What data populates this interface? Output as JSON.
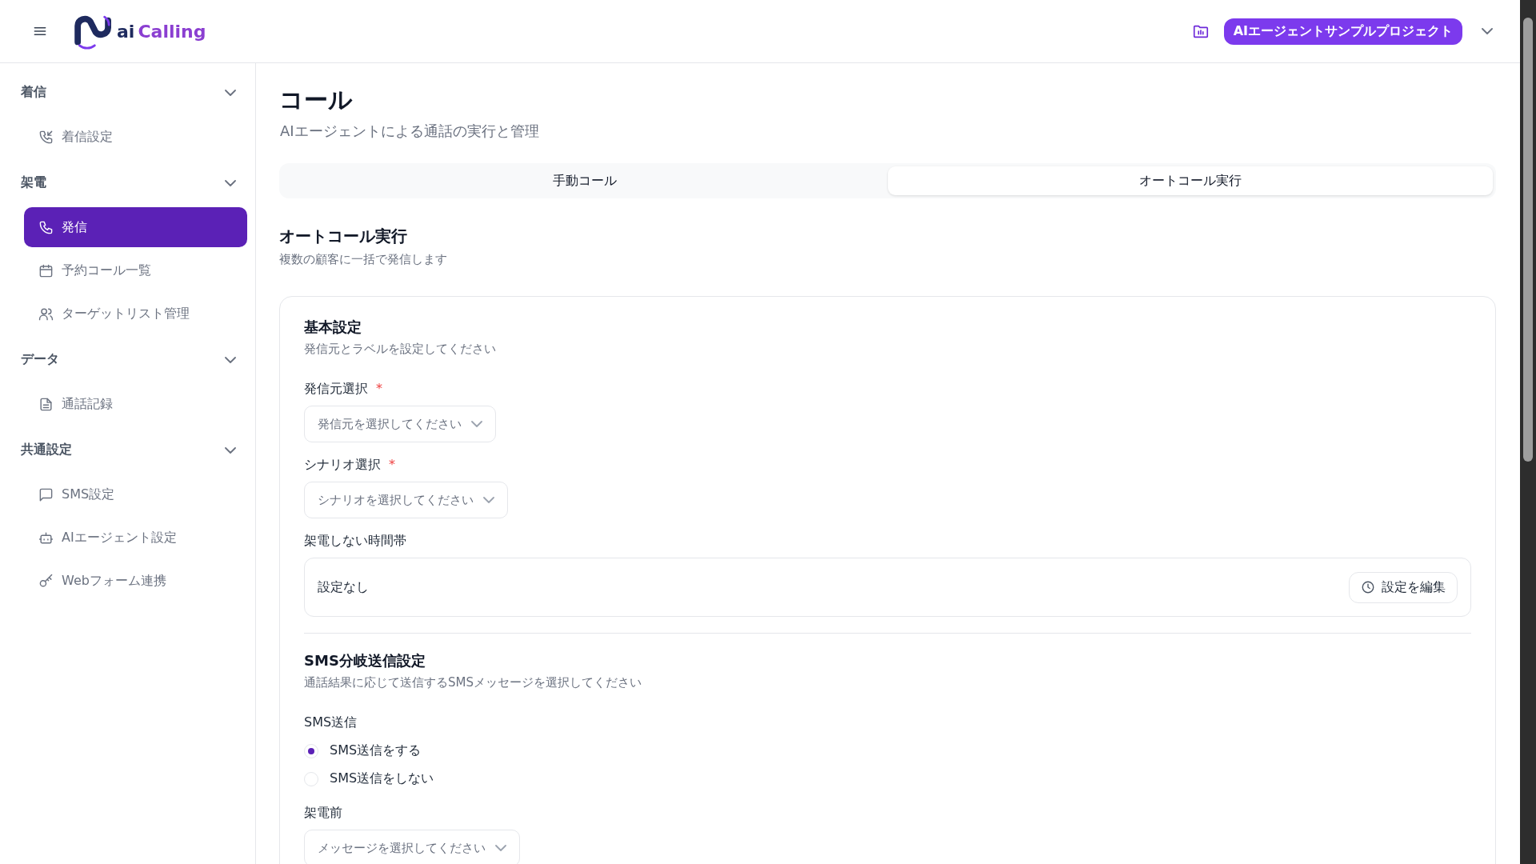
{
  "header": {
    "logo": {
      "prefix": "ai",
      "name": "Calling"
    },
    "project": "AIエージェントサンプルプロジェクト"
  },
  "sidebar": {
    "groups": [
      {
        "label": "着信",
        "expanded": true,
        "items": [
          {
            "label": "着信設定",
            "selected": false
          }
        ]
      },
      {
        "label": "架電",
        "expanded": true,
        "items": [
          {
            "label": "発信",
            "selected": true
          },
          {
            "label": "予約コール一覧",
            "selected": false
          },
          {
            "label": "ターゲットリスト管理",
            "selected": false
          }
        ]
      },
      {
        "label": "データ",
        "expanded": true,
        "items": [
          {
            "label": "通話記録",
            "selected": false
          }
        ]
      },
      {
        "label": "共通設定",
        "expanded": true,
        "items": [
          {
            "label": "SMS設定",
            "selected": false
          },
          {
            "label": "AIエージェント設定",
            "selected": false
          },
          {
            "label": "Webフォーム連携",
            "selected": false
          }
        ]
      }
    ]
  },
  "page": {
    "title": "コール",
    "subtitle": "AIエージェントによる通話の実行と管理"
  },
  "tabs": [
    {
      "label": "手動コール",
      "selected": false
    },
    {
      "label": "オートコール実行",
      "selected": true
    }
  ],
  "section": {
    "title": "オートコール実行",
    "subtitle": "複数の顧客に一括で発信します"
  },
  "card": {
    "blocks": [
      {
        "kind": "heading",
        "title": "基本設定",
        "description": "発信元とラベルを設定してください"
      },
      {
        "kind": "select",
        "label": "発信元選択",
        "required_mark": "*",
        "placeholder": "発信元を選択してください"
      },
      {
        "kind": "select",
        "label": "シナリオ選択",
        "required_mark": "*",
        "placeholder": "シナリオを選択してください"
      },
      {
        "kind": "timebox",
        "label": "架電しない時間帯",
        "value": "設定なし",
        "button": "設定を編集"
      },
      {
        "kind": "divider"
      },
      {
        "kind": "heading",
        "title": "SMS分岐送信設定",
        "description": "通話結果に応じて送信するSMSメッセージを選択してください"
      },
      {
        "kind": "radio",
        "label": "SMS送信",
        "options": [
          {
            "label": "SMS送信をする",
            "selected": true
          },
          {
            "label": "SMS送信をしない",
            "selected": false
          }
        ]
      },
      {
        "kind": "select",
        "label": "架電前",
        "placeholder": "メッセージを選択してください"
      }
    ]
  }
}
